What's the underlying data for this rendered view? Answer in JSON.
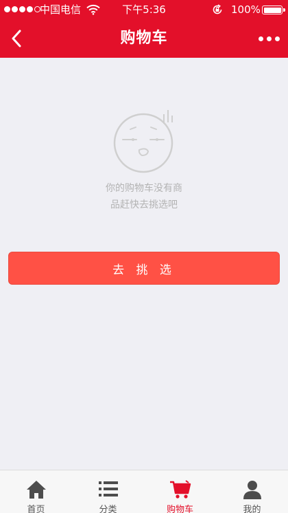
{
  "status_bar": {
    "carrier": "中国电信",
    "time": "下午5:36",
    "battery": "100%"
  },
  "nav": {
    "title": "购物车"
  },
  "empty_state": {
    "line1": "你的购物车没有商",
    "line2": "品赶快去挑选吧",
    "button_label": "去 挑 选"
  },
  "tabs": [
    {
      "label": "首页",
      "icon": "home-icon",
      "active": false
    },
    {
      "label": "分类",
      "icon": "list-icon",
      "active": false
    },
    {
      "label": "购物车",
      "icon": "cart-icon",
      "active": true
    },
    {
      "label": "我的",
      "icon": "user-icon",
      "active": false
    }
  ],
  "colors": {
    "brand_red": "#e3102a",
    "button_red": "#ff5145",
    "background": "#efeff4"
  }
}
